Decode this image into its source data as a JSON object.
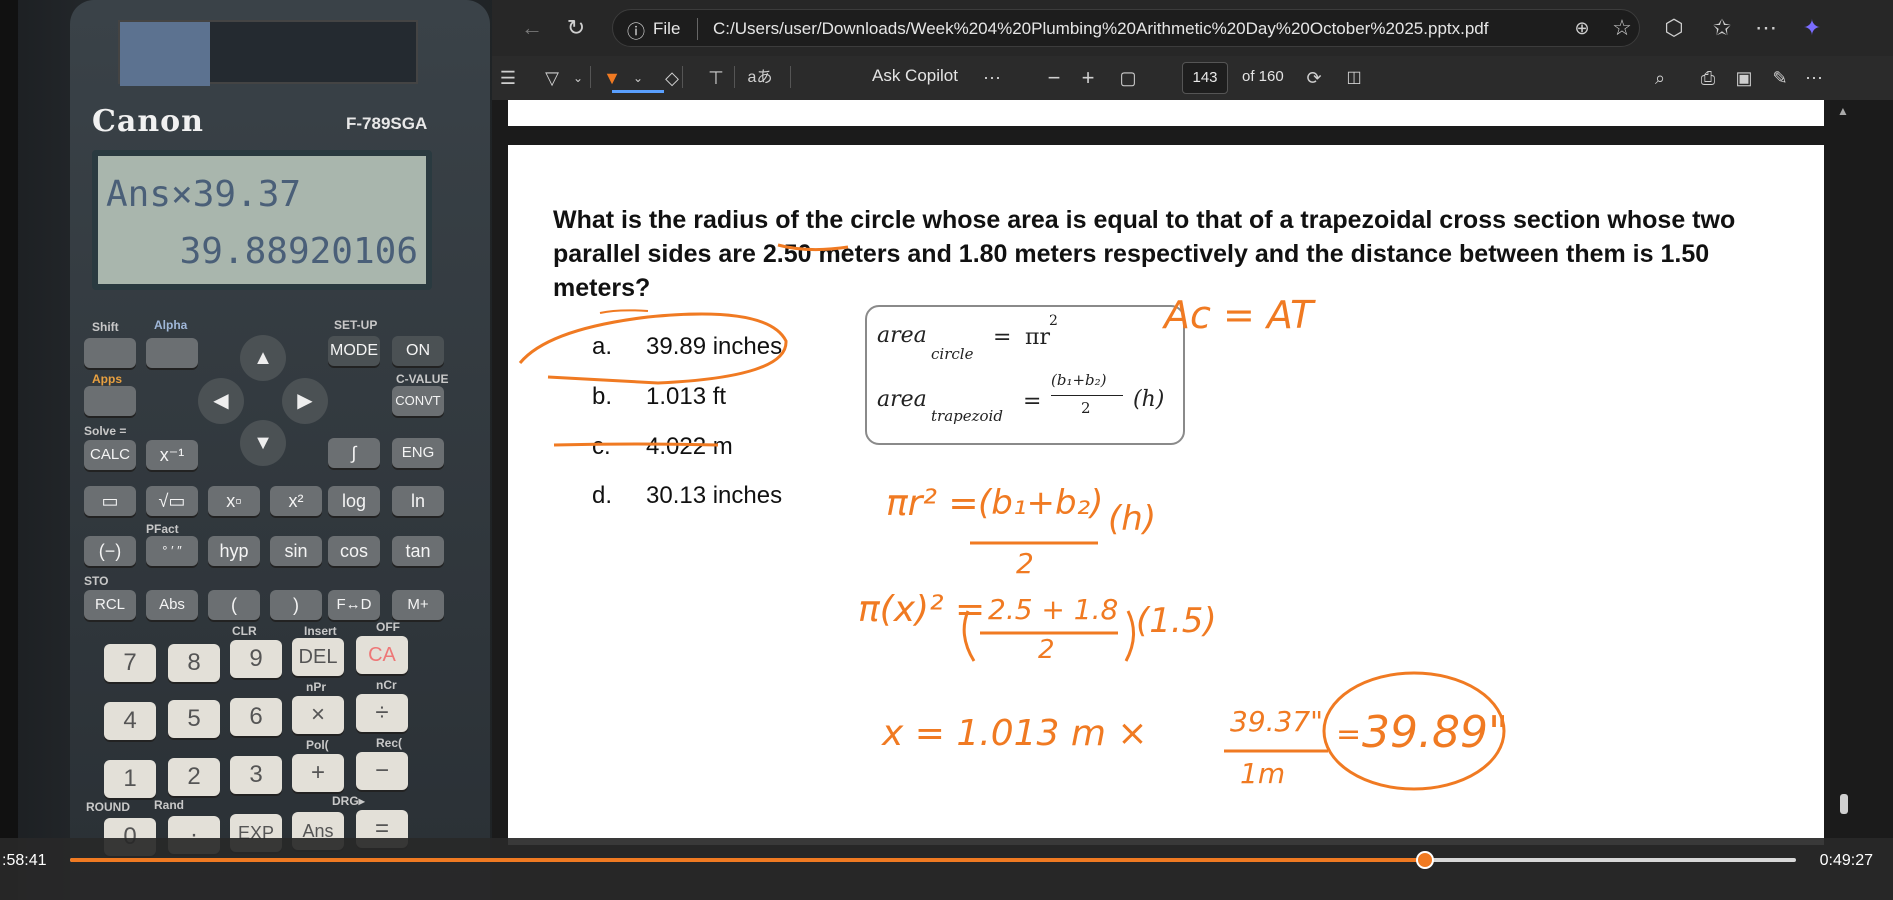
{
  "calculator": {
    "brand": "Canon",
    "model": "F-789SGA",
    "display_line1": "Ans×39.37",
    "display_line2": "39.88920106",
    "labels": {
      "shift": "Shift",
      "alpha": "Alpha",
      "setup": "SET-UP",
      "apps": "Apps",
      "cvalue": "C-VALUE",
      "solve": "Solve =",
      "sto": "STO",
      "clr": "CLR",
      "insert": "Insert",
      "off": "OFF",
      "round": "ROUND",
      "rand": "Rand",
      "randint": "Rand",
      "pfact": "PFact",
      "drg": "DRG▸",
      "npr": "nPr",
      "ncr": "nCr",
      "pol": "Pol(",
      "rec": "Rec("
    },
    "keys": {
      "mode": "MODE",
      "on": "ON",
      "convt": "CONVT",
      "calc": "CALC",
      "eng": "ENG",
      "log": "log",
      "ln": "ln",
      "hyp": "hyp",
      "sin": "sin",
      "cos": "cos",
      "tan": "tan",
      "rcl": "RCL",
      "abs": "Abs",
      "lparen": "(",
      "rparen": ")",
      "fd": "F↔D",
      "mplus": "M+",
      "n7": "7",
      "n8": "8",
      "n9": "9",
      "del": "DEL",
      "ca": "CA",
      "n4": "4",
      "n5": "5",
      "n6": "6",
      "mul": "×",
      "div": "÷",
      "n1": "1",
      "n2": "2",
      "n3": "3",
      "add": "+",
      "sub": "−",
      "n0": "0",
      "dot": "·",
      "exp": "EXP",
      "ans": "Ans",
      "eq": "="
    }
  },
  "browser": {
    "file_label": "File",
    "url": "C:/Users/user/Downloads/Week%204%20Plumbing%20Arithmetic%20Day%20October%2025.pptx.pdf",
    "ask_copilot": "Ask Copilot",
    "page_current": "143",
    "page_total": "of 160",
    "icons": {
      "back": "back-icon",
      "refresh": "refresh-icon",
      "info": "info-icon",
      "zoom": "zoom-icon",
      "favorite": "star-icon",
      "extensions": "extensions-icon",
      "favorites": "favorites-icon",
      "more": "more-icon",
      "copilot": "copilot-icon"
    }
  },
  "slide": {
    "question": "What is the radius of the circle whose area is equal to that of a trapezoidal cross section whose two parallel sides are 2.50 meters and 1.80 meters respectively and the distance between them is 1.50 meters?",
    "options": [
      {
        "letter": "a.",
        "text": "39.89 inches"
      },
      {
        "letter": "b.",
        "text": "1.013 ft"
      },
      {
        "letter": "c.",
        "text": "4.022 m"
      },
      {
        "letter": "d.",
        "text": "30.13 inches"
      }
    ],
    "formula": {
      "area": "area",
      "circle_sub": "circle",
      "trap_sub": "trapezoid",
      "eq": "=",
      "circle_rhs": "πr",
      "exp2": "2",
      "trap_num": "(b",
      "trap_num_full": "(b₁+b₂)",
      "trap_den": "2",
      "trap_h": "(h)"
    },
    "handwriting": {
      "ac_at": "Ac = AT",
      "line1_lhs": "πr² =",
      "line1_rhs": "(b₁+b₂)",
      "line1_den": "2",
      "line1_h": "(h)",
      "line2_lhs": "π(x)² =",
      "line2_num": "2.5 + 1.8",
      "line2_den": "2",
      "line2_h": "(1.5)",
      "line3": "x = 1.013 m ×",
      "line3_num": "39.37\"",
      "line3_den": "1m",
      "line3_eq": "=",
      "line3_res": "39.89\""
    }
  },
  "video": {
    "time_current": ":58:41",
    "time_end": "0:49:27",
    "progress": 0.785,
    "accent": "#f07a22"
  }
}
